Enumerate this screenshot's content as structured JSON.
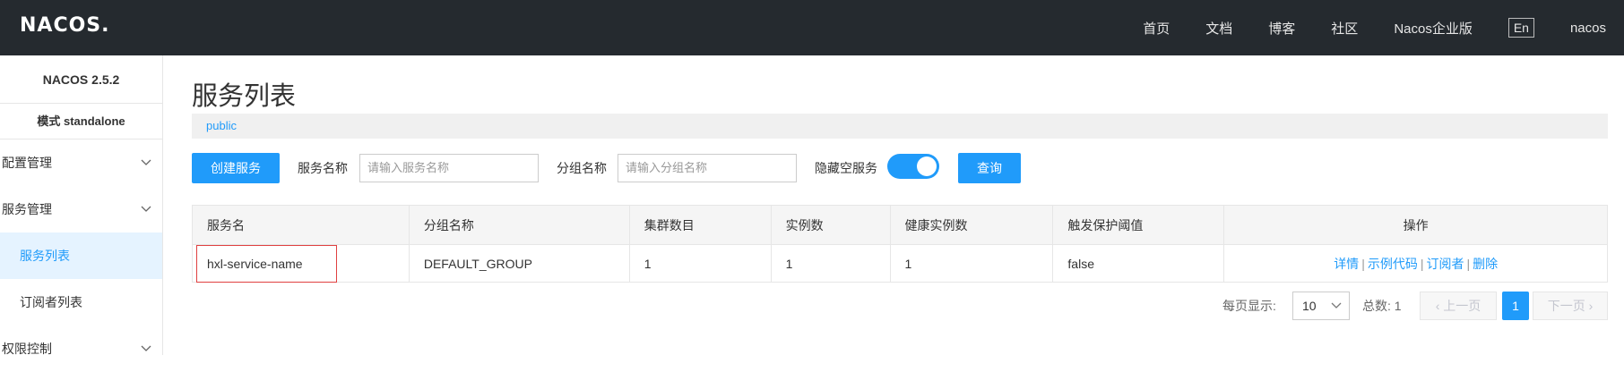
{
  "header": {
    "logo": "NACOS.",
    "nav": [
      "首页",
      "文档",
      "博客",
      "社区",
      "Nacos企业版"
    ],
    "lang": "En",
    "user": "nacos"
  },
  "sidebar": {
    "version": "NACOS 2.5.2",
    "mode": "模式 standalone",
    "groups": [
      {
        "label": "配置管理"
      },
      {
        "label": "服务管理",
        "items": [
          {
            "label": "服务列表"
          },
          {
            "label": "订阅者列表"
          }
        ]
      },
      {
        "label": "权限控制"
      }
    ]
  },
  "main": {
    "title": "服务列表",
    "namespace": "public",
    "toolbar": {
      "create_label": "创建服务",
      "service_name_label": "服务名称",
      "service_name_placeholder": "请输入服务名称",
      "group_name_label": "分组名称",
      "group_name_placeholder": "请输入分组名称",
      "hide_empty_label": "隐藏空服务",
      "hide_empty_on": true,
      "query_label": "查询"
    },
    "table": {
      "headers": [
        "服务名",
        "分组名称",
        "集群数目",
        "实例数",
        "健康实例数",
        "触发保护阈值",
        "操作"
      ],
      "rows": [
        {
          "name": "hxl-service-name",
          "group": "DEFAULT_GROUP",
          "clusters": "1",
          "instances": "1",
          "healthy": "1",
          "protect": "false",
          "ops": [
            "详情",
            "示例代码",
            "订阅者",
            "删除"
          ]
        }
      ]
    },
    "pagination": {
      "per_page_label": "每页显示:",
      "per_page": "10",
      "total_label": "总数: 1",
      "prev_label": "上一页",
      "current": "1",
      "next_label": "下一页"
    }
  },
  "colors": {
    "accent": "#209bfa",
    "topbar": "#252a2f",
    "highlight_box": "#e04040"
  }
}
